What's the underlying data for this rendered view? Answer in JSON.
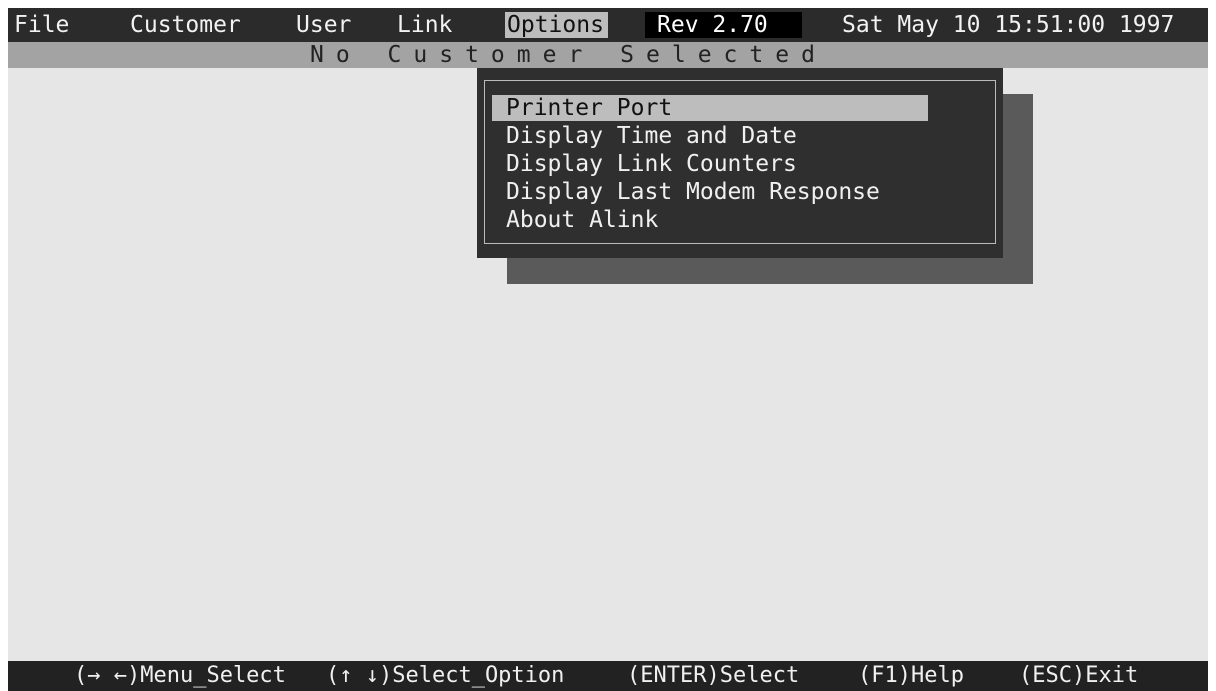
{
  "menubar": {
    "items": [
      "File",
      "Customer",
      "User",
      "Link",
      "Options"
    ],
    "active_item": "Options",
    "revision": "Rev 2.70",
    "datetime": "Sat May 10 15:51:00 1997"
  },
  "status": {
    "text": "No Customer Selected"
  },
  "options_menu": {
    "items": [
      "Printer Port",
      "Display Time and Date",
      "Display Link Counters",
      "Display Last Modem Response",
      "About Alink"
    ],
    "selected": "Printer Port"
  },
  "help_bar": {
    "hints": [
      "(→ ←)Menu_Select",
      "(↑ ↓)Select_Option",
      "(ENTER)Select",
      "(F1)Help",
      "(ESC)Exit"
    ]
  },
  "colors": {
    "screen_background": "#e6e6e6",
    "menubar_background": "#2b2b2b",
    "status_background": "#a3a3a3",
    "dropdown_background": "#2f2f2f",
    "dropdown_shadow": "#5a5a5a",
    "highlight": "#bdbdbd"
  }
}
